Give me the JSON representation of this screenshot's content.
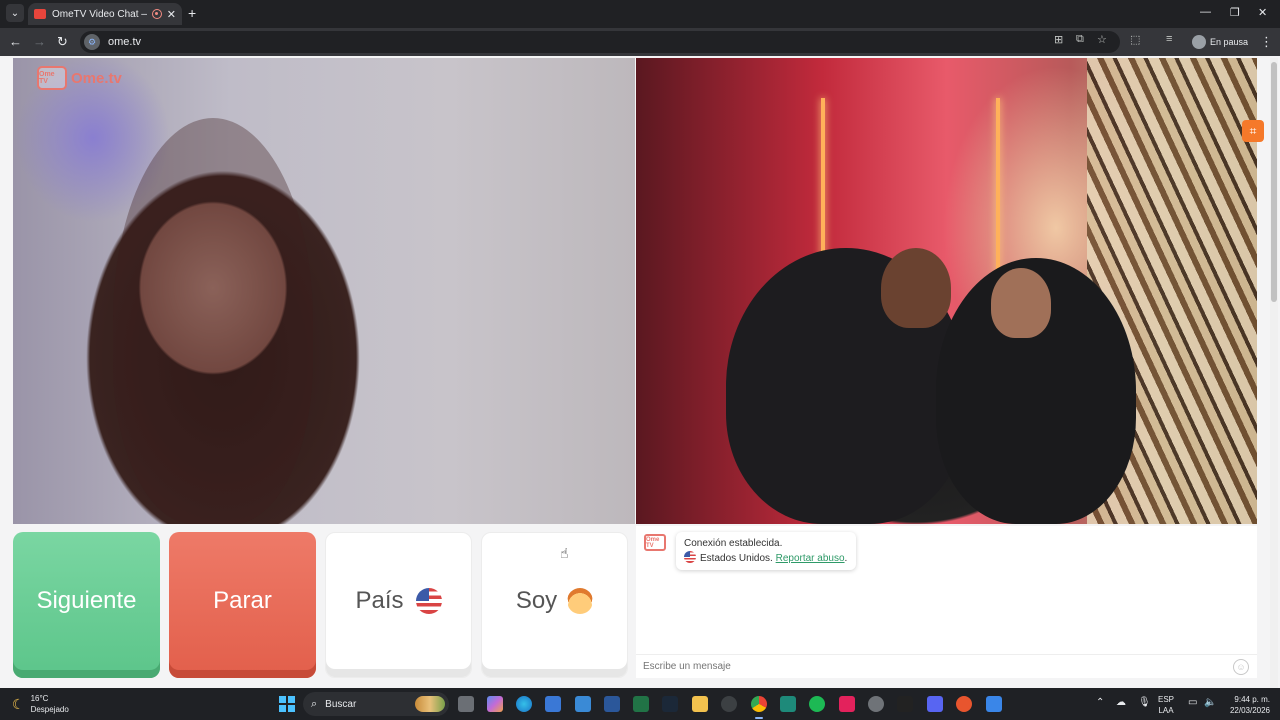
{
  "browser": {
    "tab_title": "OmeTV Video Chat — Ome",
    "new_tab_glyph": "+",
    "url": "ome.tv",
    "profile_label": "En pausa",
    "window_controls": [
      "—",
      "❐",
      "✕"
    ]
  },
  "page": {
    "logo_badge": "Ome TV",
    "logo_text": "Ome.tv",
    "buttons": {
      "next": "Siguiente",
      "stop": "Parar",
      "country": "País",
      "gender": "Soy"
    },
    "chat": {
      "logo_badge": "Ome TV",
      "status": "Conexión establecida.",
      "country_text": "Estados Unidos.",
      "report_link": "Reportar abuso",
      "report_suffix": ".",
      "input_placeholder": "Escribe un mensaje"
    },
    "colors": {
      "next": "#5cc58a",
      "stop": "#e25f4b",
      "brand": "#e8776f",
      "link": "#2e9a68"
    }
  },
  "taskbar": {
    "weather_temp": "16°C",
    "weather_desc": "Despejado",
    "search_label": "Buscar",
    "lang_top": "ESP",
    "lang_bottom": "LAA",
    "time": "9:44 p. m.",
    "date": "22/03/2026"
  }
}
